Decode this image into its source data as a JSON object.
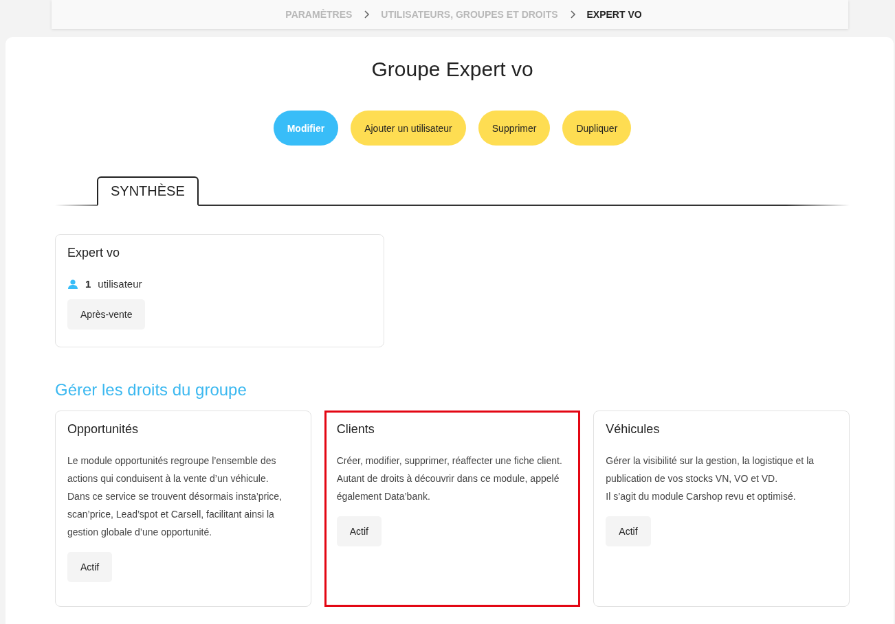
{
  "breadcrumb": [
    {
      "label": "PARAMÈTRES",
      "current": false
    },
    {
      "label": "UTILISATEURS, GROUPES ET DROITS",
      "current": false
    },
    {
      "label": "EXPERT VO",
      "current": true
    }
  ],
  "title": "Groupe Expert vo",
  "actions": [
    {
      "label": "Modifier",
      "kind": "primary"
    },
    {
      "label": "Ajouter un utilisateur",
      "kind": "secondary"
    },
    {
      "label": "Supprimer",
      "kind": "secondary"
    },
    {
      "label": "Dupliquer",
      "kind": "secondary"
    }
  ],
  "tabs": [
    {
      "label": "SYNTHÈSE",
      "selected": true
    }
  ],
  "summary": {
    "name": "Expert vo",
    "user_count": "1",
    "user_label": "utilisateur",
    "tags": [
      "Après-vente"
    ]
  },
  "rights_heading": "Gérer les droits du groupe",
  "modules": [
    {
      "title": "Opportunités",
      "paragraphs": [
        "Le module opportunités regroupe l’ensemble des actions qui conduisent à la vente d’un véhicule.",
        "Dans ce service se trouvent désormais insta’price, scan’price, Lead’spot et Carsell, facilitant ainsi la gestion globale d’une opportunité."
      ],
      "status": "Actif",
      "highlighted": false
    },
    {
      "title": "Clients",
      "paragraphs": [
        "Créer, modifier, supprimer, réaffecter une fiche client.",
        "Autant de droits à découvrir dans ce module, appelé également Data’bank."
      ],
      "status": "Actif",
      "highlighted": true
    },
    {
      "title": "Véhicules",
      "paragraphs": [
        "Gérer la visibilité sur la gestion, la logistique et la publication de vos stocks VN, VO et VD.",
        "Il s’agit du module Carshop revu et optimisé."
      ],
      "status": "Actif",
      "highlighted": false
    }
  ]
}
